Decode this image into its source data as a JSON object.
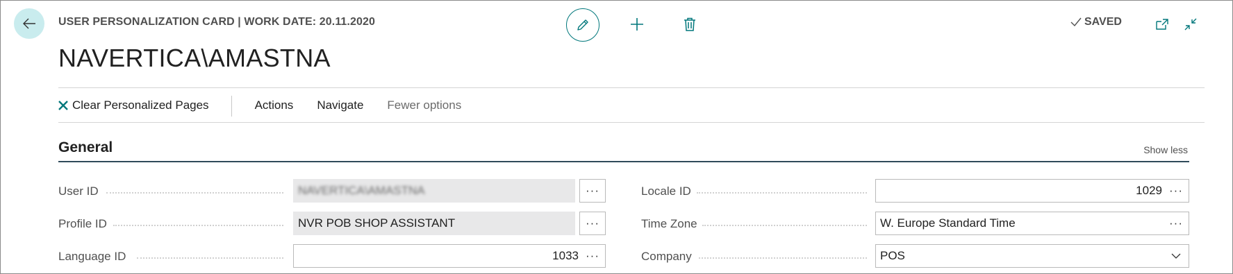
{
  "header": {
    "caption": "USER PERSONALIZATION CARD | WORK DATE: 20.11.2020",
    "title": "NAVERTICA\\AMASTNA",
    "saved_label": "SAVED"
  },
  "icons": {
    "back": "arrow-left-icon",
    "edit": "pencil-icon",
    "add": "plus-icon",
    "delete": "trash-icon",
    "popout": "open-new-window-icon",
    "collapse": "collapse-icon",
    "clear": "x-icon"
  },
  "actions": {
    "clear_label": "Clear Personalized Pages",
    "actions_label": "Actions",
    "navigate_label": "Navigate",
    "fewer_label": "Fewer options"
  },
  "section": {
    "title": "General",
    "toggle_label": "Show less"
  },
  "fields": {
    "user_id": {
      "label": "User ID",
      "value": "NAVERTICA\\AMASTNA"
    },
    "profile_id": {
      "label": "Profile ID",
      "value": "NVR POB SHOP ASSISTANT"
    },
    "language_id": {
      "label": "Language ID",
      "value": "1033"
    },
    "locale_id": {
      "label": "Locale ID",
      "value": "1029"
    },
    "time_zone": {
      "label": "Time Zone",
      "value": "W. Europe Standard Time"
    },
    "company": {
      "label": "Company",
      "value": "POS"
    }
  },
  "assist_glyph": "···",
  "colors": {
    "accent": "#00777b",
    "back_bg": "#c9ecee",
    "readonly_bg": "#e8e8e9",
    "section_rule": "#2f4a5a"
  }
}
